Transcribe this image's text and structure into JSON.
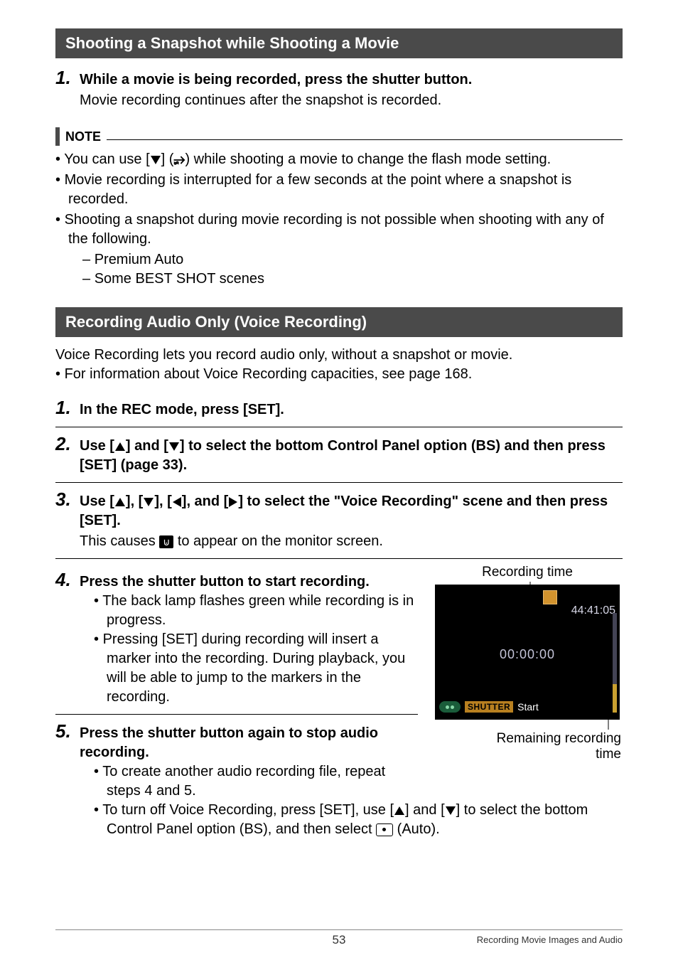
{
  "section1": {
    "title": "Shooting a Snapshot while Shooting a Movie",
    "step1_title": "While a movie is being recorded, press the shutter button.",
    "step1_text": "Movie recording continues after the snapshot is recorded."
  },
  "note": {
    "label": "NOTE",
    "b1a": "You can use [",
    "b1b": "] (",
    "b1c": ") while shooting a movie to change the flash mode setting.",
    "b2": "Movie recording is interrupted for a few seconds at the point where a snapshot is recorded.",
    "b3": "Shooting a snapshot during movie recording is not possible when shooting with any of the following.",
    "sub1": "Premium Auto",
    "sub2": "Some BEST SHOT scenes"
  },
  "section2": {
    "title": "Recording Audio Only (Voice Recording)",
    "intro": "Voice Recording lets you record audio only, without a snapshot or movie.",
    "intro_b": "For information about Voice Recording capacities, see page 168.",
    "step1": "In the REC mode, press [SET].",
    "step2a": "Use [",
    "step2b": "] and [",
    "step2c": "] to select the bottom Control Panel option (BS) and then press [SET] (page 33).",
    "step3a": "Use [",
    "step3b": "], [",
    "step3c": "], [",
    "step3d": "], and [",
    "step3e": "] to select the \"Voice Recording\" scene and then press [SET].",
    "step3txt_a": "This causes ",
    "step3txt_b": " to appear on the monitor screen.",
    "step4": "Press the shutter button to start recording.",
    "step4_b1": "The back lamp flashes green while recording is in progress.",
    "step4_b2": "Pressing [SET] during recording will insert a marker into the recording. During playback, you will be able to jump to the markers in the recording.",
    "step5": "Press the shutter button again to stop audio recording.",
    "step5_b1": "To create another audio recording file, repeat steps 4 and 5.",
    "step5_b2a": "To turn off Voice Recording, press [SET], use [",
    "step5_b2b": "] and [",
    "step5_b2c": "] to select the bottom Control Panel option (BS), and then select ",
    "step5_b2d": " (Auto)."
  },
  "screenshot": {
    "label_top": "Recording time",
    "remaining": "44:41:05",
    "elapsed": "00:00:00",
    "shutter": "SHUTTER",
    "start": "Start",
    "label_bottom1": "Remaining recording",
    "label_bottom2": "time"
  },
  "footer": {
    "page": "53",
    "text": "Recording Movie Images and Audio"
  },
  "nums": {
    "n1": "1.",
    "n2": "2.",
    "n3": "3.",
    "n4": "4.",
    "n5": "5."
  },
  "glyphs": {
    "flash": "⚡",
    "mic": "●"
  }
}
